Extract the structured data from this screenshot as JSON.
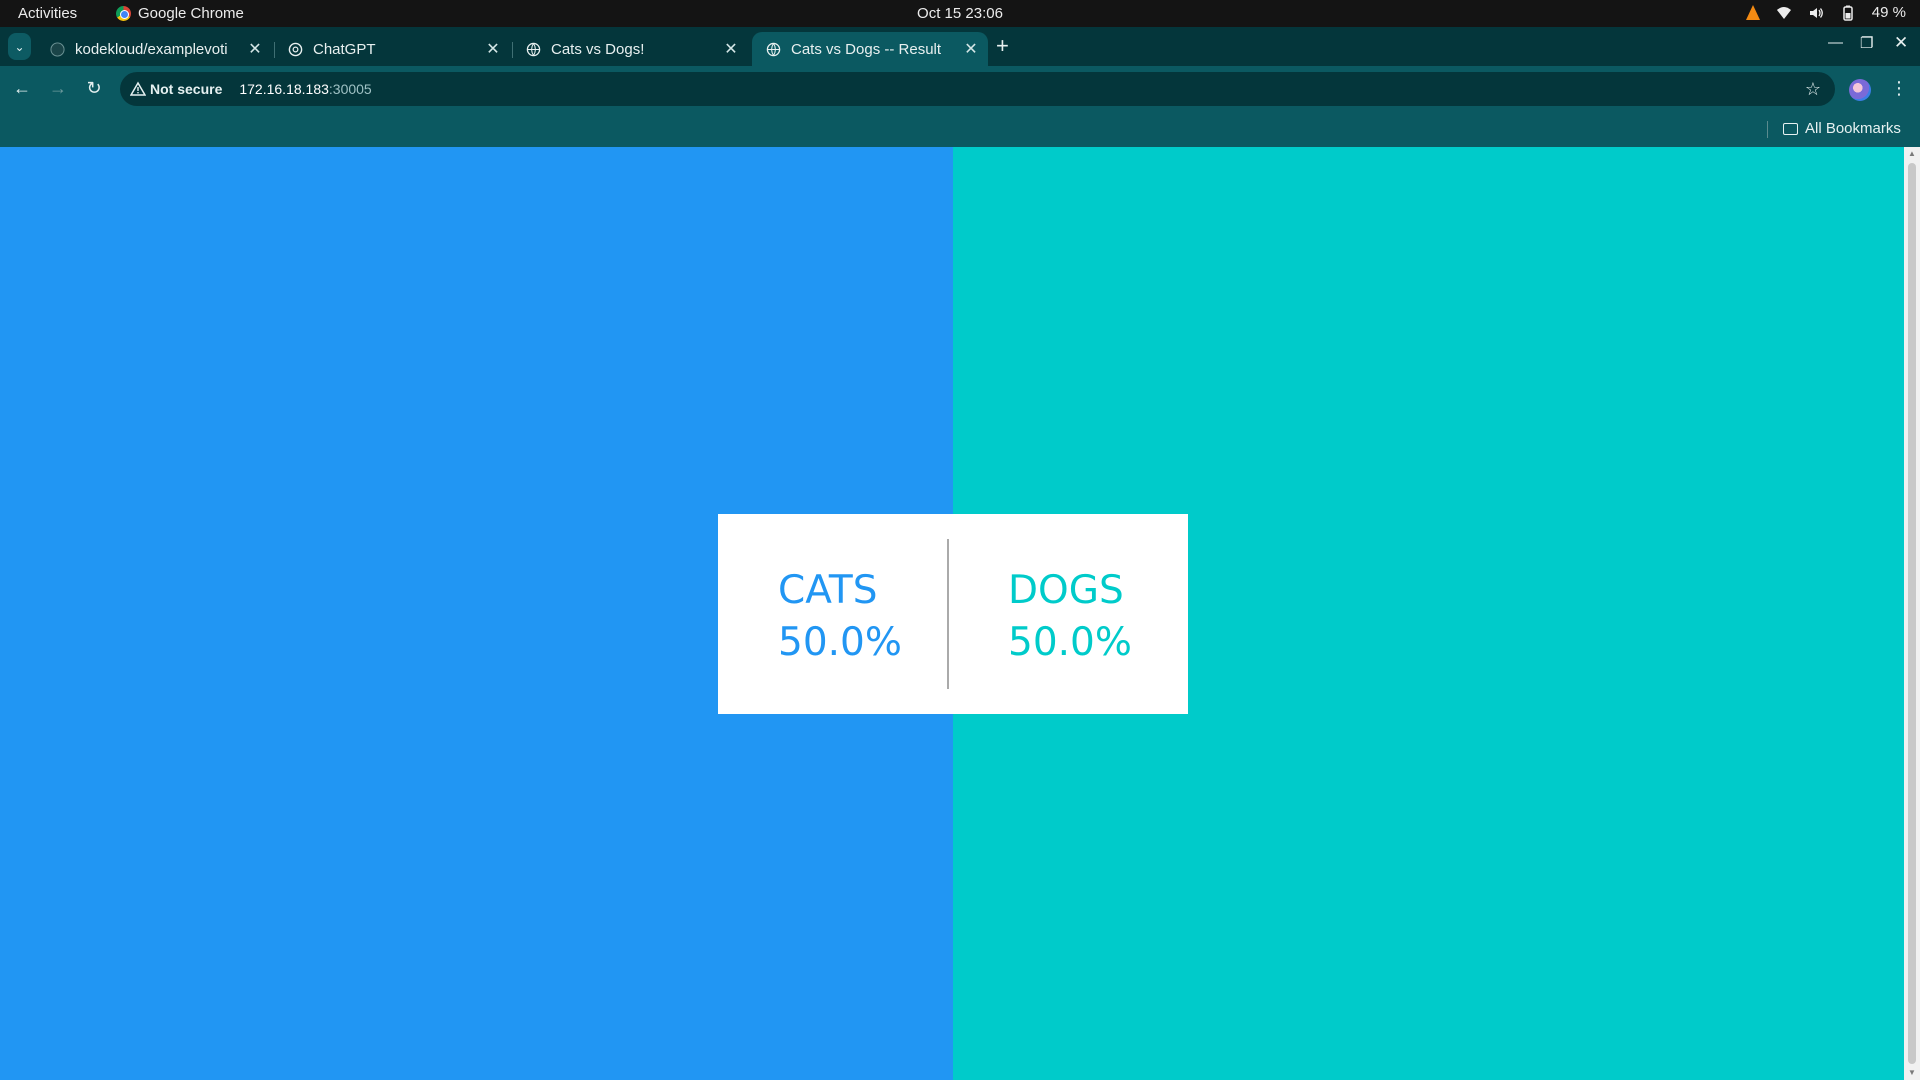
{
  "system_bar": {
    "activities": "Activities",
    "app_name": "Google Chrome",
    "clock": "Oct 15  23:06",
    "battery": "49 %"
  },
  "tabs": [
    {
      "title": "kodekloud/examplevoti",
      "icon": "github-icon",
      "active": false
    },
    {
      "title": "ChatGPT",
      "icon": "chatgpt-icon",
      "active": false
    },
    {
      "title": "Cats vs Dogs!",
      "icon": "globe-icon",
      "active": false
    },
    {
      "title": "Cats vs Dogs -- Result",
      "icon": "globe-icon",
      "active": true
    }
  ],
  "toolbar": {
    "security_label": "Not secure",
    "url_host": "172.16.18.183",
    "url_port": ":30005"
  },
  "bookmarks_bar": {
    "all_bookmarks": "All Bookmarks"
  },
  "page": {
    "colors": {
      "cats": "#2196f3",
      "dogs": "#00cbca"
    },
    "results": {
      "cats": {
        "label": "CATS",
        "percent": "50.0%"
      },
      "dogs": {
        "label": "DOGS",
        "percent": "50.0%"
      }
    }
  }
}
